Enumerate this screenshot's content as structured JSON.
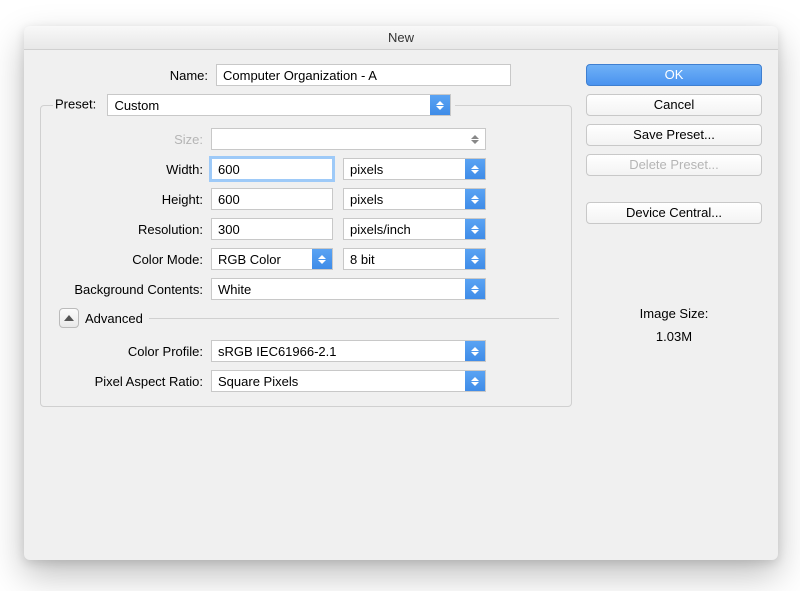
{
  "title": "New",
  "name_label": "Name:",
  "name_value": "Computer Organization - A",
  "preset_legend": "Preset:",
  "preset_value": "Custom",
  "size_label": "Size:",
  "size_value": "",
  "width_label": "Width:",
  "width_value": "600",
  "width_unit": "pixels",
  "height_label": "Height:",
  "height_value": "600",
  "height_unit": "pixels",
  "resolution_label": "Resolution:",
  "resolution_value": "300",
  "resolution_unit": "pixels/inch",
  "color_mode_label": "Color Mode:",
  "color_mode_value": "RGB Color",
  "color_depth_value": "8 bit",
  "bg_label": "Background Contents:",
  "bg_value": "White",
  "advanced_label": "Advanced",
  "color_profile_label": "Color Profile:",
  "color_profile_value": "sRGB IEC61966-2.1",
  "par_label": "Pixel Aspect Ratio:",
  "par_value": "Square Pixels",
  "buttons": {
    "ok": "OK",
    "cancel": "Cancel",
    "save_preset": "Save Preset...",
    "delete_preset": "Delete Preset...",
    "device_central": "Device Central..."
  },
  "image_size_label": "Image Size:",
  "image_size_value": "1.03M"
}
